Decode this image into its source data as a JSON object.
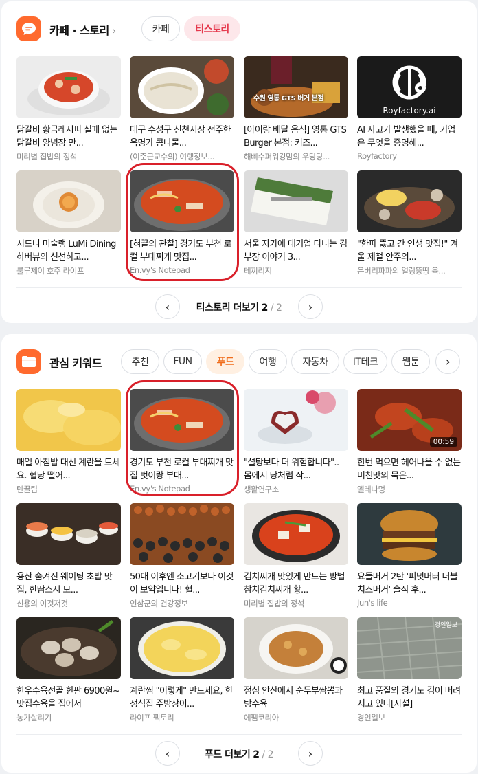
{
  "cafe_story": {
    "title": "카페 · 스토리",
    "tabs": [
      {
        "label": "카페",
        "active": false
      },
      {
        "label": "티스토리",
        "active": true
      }
    ],
    "items": [
      {
        "title": "닭갈비 황금레시피 실패 없는 닭갈비 양념장 만...",
        "source": "미리별 집밥의 정석",
        "thumb": "food-chicken-galbi"
      },
      {
        "title": "대구 수성구 신천시장 전주한옥명가 콩나물...",
        "source": "(이준근교수의) 여행정보...",
        "thumb": "food-bean-sprout-soup"
      },
      {
        "title": "[아이랑 배달 음식] 영통 GTS Burger 본점: 키즈...",
        "source": "해삐수퍼워킹맘의 우당탕...",
        "thumb": "food-burger-fries",
        "overlay": "수원 영통 GTS 버거 본점"
      },
      {
        "title": "AI 사고가 발생했을 때, 기업은 무엇을 증명해...",
        "source": "Royfactory",
        "thumb": "logo-royfactory",
        "overlay": "Royfactory.ai"
      },
      {
        "title": "시드니 미술랭 LuMi Dining 하버뷰의 신선하고...",
        "source": "룰루제이 호주 라이프",
        "thumb": "food-plated-dish"
      },
      {
        "title": "[혀끝의 관찰] 경기도 부천 로컬 부대찌개 맛집...",
        "source": "En.vy's Notepad",
        "thumb": "food-budae-jjigae"
      },
      {
        "title": "서울 자가에 대기업 다니는 김부장 이야기 3...",
        "source": "테끼리지",
        "thumb": "book-cover"
      },
      {
        "title": "\"한파 뚫고 간 인생 맛집!\" 겨울 제철 안주의...",
        "source": "은버리파파의 얼렁뚱땅 육...",
        "thumb": "food-seafood-platter"
      }
    ],
    "pager": {
      "label": "티스토리 더보기",
      "current": "2",
      "total": "/ 2"
    }
  },
  "keywords": {
    "title": "관심 키워드",
    "tabs": [
      {
        "label": "추천",
        "active": false
      },
      {
        "label": "FUN",
        "active": false
      },
      {
        "label": "푸드",
        "active": true
      },
      {
        "label": "여행",
        "active": false
      },
      {
        "label": "자동차",
        "active": false
      },
      {
        "label": "IT테크",
        "active": false
      },
      {
        "label": "웹툰",
        "active": false
      }
    ],
    "items": [
      {
        "title": "매일 아침밥 대신 계란을 드세요. 혈당 떨어...",
        "source": "텐꿀팁",
        "thumb": "food-scrambled-egg"
      },
      {
        "title": "경기도 부천 로컬 부대찌개 맛집 벗이랑 부대...",
        "source": "En.vy's Notepad",
        "thumb": "food-budae-jjigae"
      },
      {
        "title": "\"설탕보다 더 위험합니다\".. 몸에서 당처럼 작...",
        "source": "생활연구소",
        "thumb": "food-heart-cake"
      },
      {
        "title": "한번 먹으면 헤어나올 수 없는 미친맛의 묵은...",
        "source": "엘레나멍",
        "thumb": "food-braised-chicken",
        "badge": "00:59"
      },
      {
        "title": "용산 숨겨진 웨이팅 초밥 맛집, 한땀스시 모...",
        "source": "신용의 이것저것",
        "thumb": "food-sushi"
      },
      {
        "title": "50대 이후엔 소고기보다 이것이 보약입니다! 혈...",
        "source": "인삼군의 건강정보",
        "thumb": "food-beans"
      },
      {
        "title": "김치찌개 맛있게 만드는 방법 참치김치찌개 황...",
        "source": "미리별 집밥의 정석",
        "thumb": "food-kimchi-stew"
      },
      {
        "title": "요들버거 2탄 '피넛버터 더블치즈버거' 솔직 후...",
        "source": "Jun's life",
        "thumb": "food-burger"
      },
      {
        "title": "한우수육전골 한판 6900원~맛집수육을 집에서",
        "source": "농가살리기",
        "thumb": "food-boiled-beef"
      },
      {
        "title": "계란찜 \"이렇게\" 만드세요, 한정식집 주방장이...",
        "source": "라이프 팩토리",
        "thumb": "food-steamed-egg"
      },
      {
        "title": "점심 안산에서 순두부짬뽕과 탕수육",
        "source": "에펨코리아",
        "thumb": "food-sweet-sour-pork"
      },
      {
        "title": "최고 품질의 경기도 김이 버려지고 있다[사설]",
        "source": "경인일보",
        "thumb": "aerial-seaweed-farm",
        "overlay": "경인일보"
      }
    ],
    "pager": {
      "label": "푸드 더보기",
      "current": "2",
      "total": "/ 2"
    }
  },
  "colors": {
    "accent_orange": "#ff6a2e",
    "highlight_red": "#d9202a",
    "active_tab_red": "#e5394d",
    "active_tab_orange": "#f06d1c"
  }
}
